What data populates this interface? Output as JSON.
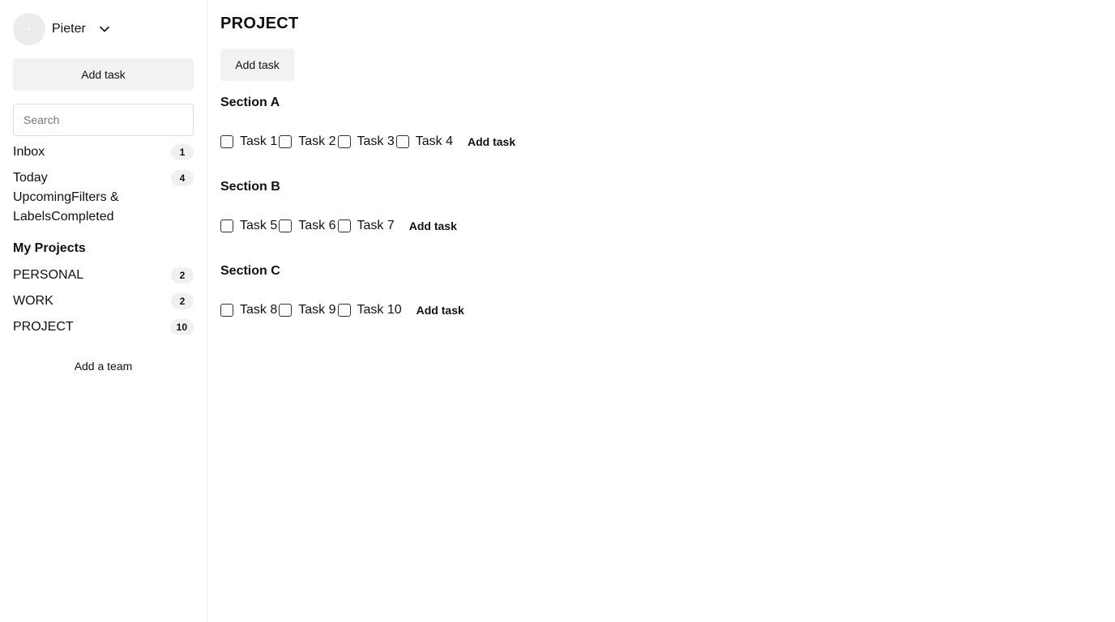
{
  "user": {
    "name": "Pieter"
  },
  "sidebar": {
    "add_task_label": "Add task",
    "search_placeholder": "Search",
    "inbox": {
      "label": "Inbox",
      "count": "1"
    },
    "today": {
      "label": "Today",
      "count": "4"
    },
    "other_links_text": "UpcomingFilters & LabelsCompleted",
    "projects_heading": "My Projects",
    "projects": [
      {
        "label": "PERSONAL",
        "count": "2"
      },
      {
        "label": "WORK",
        "count": "2"
      },
      {
        "label": "PROJECT",
        "count": "10"
      }
    ],
    "add_team_label": "Add a team"
  },
  "main": {
    "title": "PROJECT",
    "add_task_label": "Add task",
    "sections": [
      {
        "title": "Section A",
        "tasks": [
          "Task 1",
          "Task 2",
          "Task 3",
          "Task 4"
        ],
        "add_task_label": "Add task"
      },
      {
        "title": "Section B",
        "tasks": [
          "Task 5",
          "Task 6",
          "Task 7"
        ],
        "add_task_label": "Add task"
      },
      {
        "title": "Section C",
        "tasks": [
          "Task 8",
          "Task 9",
          "Task 10"
        ],
        "add_task_label": "Add task"
      }
    ]
  },
  "icons": {
    "profile_menu": "chevron-down-icon"
  }
}
